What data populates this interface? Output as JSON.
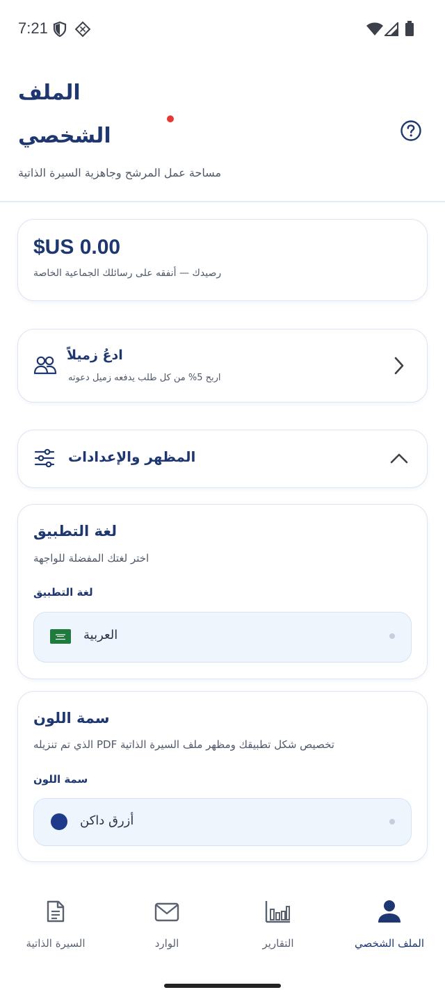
{
  "status_bar": {
    "time": "7:21",
    "icons": [
      "shield-icon",
      "diamond-grid-icon",
      "wifi-icon",
      "signal-icon",
      "battery-icon"
    ]
  },
  "header": {
    "title_line1": "الملف",
    "title_line2": "الشخصي",
    "subtitle": "مساحة عمل المرشح وجاهزية السيرة الذاتية",
    "help_icon": "help-circle-icon"
  },
  "balance": {
    "amount": "$US 0.00",
    "description": "رصيدك — أنفقه على رسائلك الجماعية الخاصة"
  },
  "invite": {
    "title": "ادعُ زميلاً",
    "description": "اربح 5% من كل طلب يدفعه زميل دعوته",
    "icon": "users-icon"
  },
  "settings": {
    "title": "المظهر والإعدادات",
    "icon": "sliders-icon",
    "expanded": true
  },
  "language": {
    "title": "لغة التطبيق",
    "description": "اختر لغتك المفضلة للواجهة",
    "field_label": "لغة التطبيق",
    "selected": "العربية",
    "flag_icon": "saudi-flag-icon"
  },
  "theme": {
    "title": "سمة اللون",
    "description": "تخصيص شكل تطبيقك ومظهر ملف السيرة الذاتية PDF الذي تم تنزيله",
    "field_label": "سمة اللون",
    "selected": "أزرق داكن",
    "swatch_color": "#1e3a8a"
  },
  "bottom_nav": {
    "items": [
      {
        "label": "السيرة الذاتية",
        "icon": "document-icon"
      },
      {
        "label": "الوارد",
        "icon": "mail-icon"
      },
      {
        "label": "التقارير",
        "icon": "bar-chart-icon"
      },
      {
        "label": "الملف الشخصي",
        "icon": "person-icon",
        "active": true
      }
    ]
  },
  "colors": {
    "primary": "#1e3770",
    "accent_red": "#e53935",
    "select_bg": "#eef5fd"
  }
}
